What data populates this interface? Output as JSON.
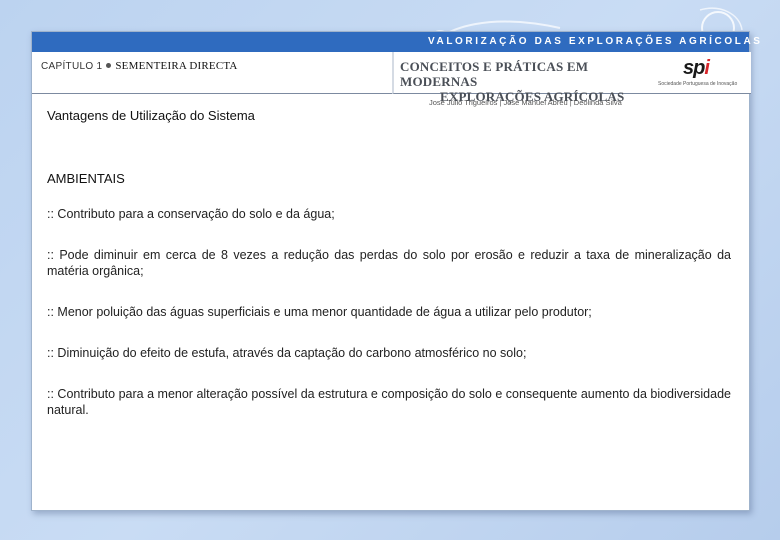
{
  "header": {
    "series_title": "VALORIZAÇÃO DAS EXPLORAÇÕES AGRÍCOLAS",
    "chapter_label": "CAPÍTULO 1",
    "chapter_title": "SEMENTEIRA DIRECTA",
    "book_title_line1": "CONCEITOS E PRÁTICAS EM MODERNAS",
    "book_title_line2": "EXPLORAÇÕES AGRÍCOLAS",
    "logo_text_main": "sp",
    "logo_text_accent": "i",
    "logo_subtitle": "Sociedade Portuguesa de Inovação",
    "authors": "José Júlio Trigueiros | José Manuel Abreu | Deolinda Silva"
  },
  "section": {
    "title": "Vantagens de Utilização do Sistema",
    "heading": "AMBIENTAIS",
    "items": [
      ":: Contributo para a conservação do solo e da água;",
      ":: Pode diminuir em cerca de 8 vezes a redução das perdas do solo por erosão e reduzir a taxa de mineralização da matéria orgânica;",
      ":: Menor poluição das águas superficiais e uma menor quantidade de água a utilizar pelo produtor;",
      ":: Diminuição do efeito de estufa, através da captação do carbono atmosférico no solo;",
      ":: Contributo para a menor alteração possível da estrutura e composição do solo e consequente aumento da biodiversidade natural."
    ]
  },
  "colors": {
    "header_bar": "#2f6bbf",
    "background": "#c4d8f2",
    "logo_accent": "#d8262b"
  }
}
